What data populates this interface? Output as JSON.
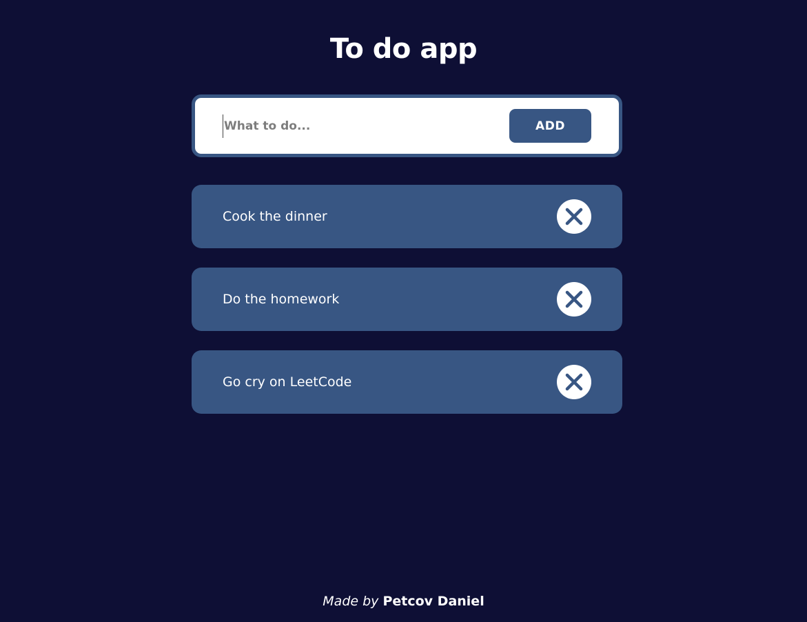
{
  "header": {
    "title": "To do app"
  },
  "input_form": {
    "placeholder": "What to do...",
    "value": "",
    "add_label": "ADD"
  },
  "tasks": [
    {
      "label": "Cook the dinner",
      "delete_icon": "close-icon"
    },
    {
      "label": "Do the homework",
      "delete_icon": "close-icon"
    },
    {
      "label": "Go cry on LeetCode",
      "delete_icon": "close-icon"
    }
  ],
  "footer": {
    "made_by": "Made by",
    "author": "Petcov Daniel"
  },
  "colors": {
    "background": "#0e0f35",
    "accent": "#385683",
    "surface": "#ffffff"
  }
}
